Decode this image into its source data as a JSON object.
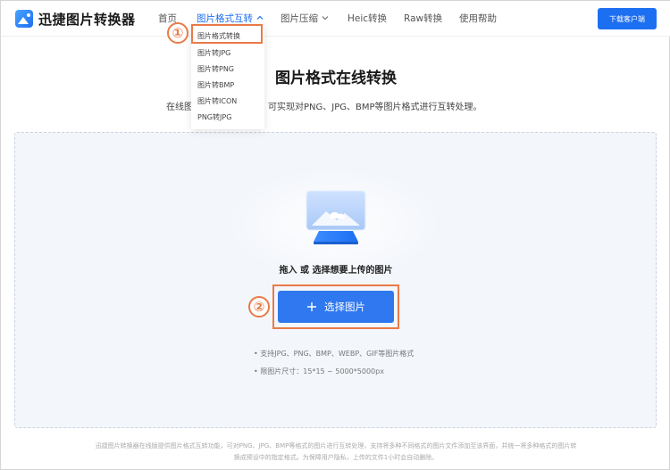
{
  "header": {
    "logo_text": "迅捷图片转换器",
    "nav": [
      {
        "label": "首页"
      },
      {
        "label": "图片格式互转"
      },
      {
        "label": "图片压缩"
      },
      {
        "label": "Heic转换"
      },
      {
        "label": "Raw转换"
      },
      {
        "label": "使用帮助"
      }
    ],
    "download_label": "下载客户端",
    "accent_color": "#1d6ff2"
  },
  "dropdown": {
    "items": [
      {
        "label": "图片格式转换"
      },
      {
        "label": "图片转JPG"
      },
      {
        "label": "图片转PNG"
      },
      {
        "label": "图片转BMP"
      },
      {
        "label": "图片转ICON"
      },
      {
        "label": "PNG转JPG"
      }
    ]
  },
  "annotations": {
    "badge_1": "①",
    "badge_2": "②",
    "highlight_color": "#ea7a48"
  },
  "main": {
    "title": "图片格式在线转换",
    "subtitle_start": "在线图",
    "subtitle_end": "，可实现对PNG、JPG、BMP等图片格式进行互转处理。",
    "drop_text": "拖入 或 选择想要上传的图片",
    "select_button_label": "选择图片",
    "notes": [
      "• 支持JPG、PNG、BMP、WEBP、GIF等图片格式",
      "• 限图片尺寸：15*15 ~ 5000*5000px"
    ]
  },
  "footer": {
    "line1": "迅捷图片转换器在线版提供图片格式互转功能，可对PNG、JPG、BMP等格式的图片进行互转处理，支持将多种不同格式的图片文件添加至该界面，并统一将多种格式的图片转",
    "line2": "换成预设中的指定格式。为保障用户隐私，上传的文件1小时会自动删除。"
  }
}
